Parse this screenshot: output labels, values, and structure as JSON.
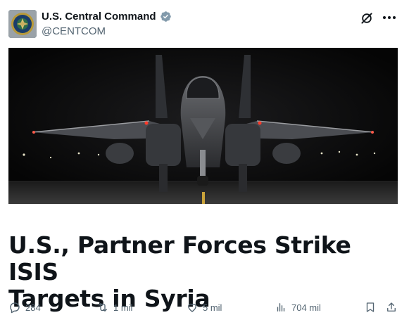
{
  "post": {
    "author": {
      "display_name": "U.S. Central Command",
      "handle": "@CENTCOM",
      "verified": true,
      "avatar_icon": "centcom-seal",
      "verified_badge_color": "#829aab"
    },
    "media": {
      "icon": "f15-fighter-jet-photo"
    },
    "headline": {
      "line1": "U.S., Partner Forces Strike ISIS",
      "line2": "Targets in Syria"
    },
    "actions": {
      "replies": "284",
      "reposts": "1 mil",
      "likes": "5 mil",
      "views": "704 mil"
    }
  },
  "colors": {
    "text_primary": "#0f1419",
    "text_secondary": "#536471"
  }
}
